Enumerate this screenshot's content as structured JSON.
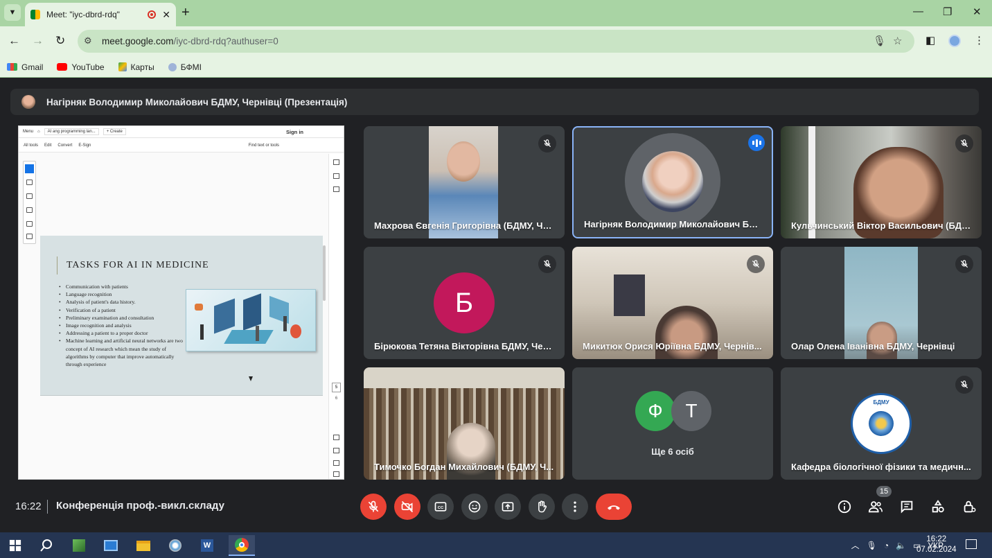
{
  "browser": {
    "tab_title": "Meet: \"iyc-dbrd-rdq\"",
    "url_host": "meet.google.com",
    "url_path": "/iyc-dbrd-rdq?authuser=0",
    "bookmarks": [
      "Gmail",
      "YouTube",
      "Карты",
      "БФМІ"
    ]
  },
  "presenter_bar": {
    "title": "Нагірняк Володимир Миколайович БДМУ, Чернівці (Презентація)"
  },
  "presentation": {
    "app_menu": "Menu",
    "doc_tab": "AI ang programming lan...",
    "create": "+ Create",
    "sign_in": "Sign in",
    "tools": [
      "All tools",
      "Edit",
      "Convert",
      "E-Sign"
    ],
    "find": "Find text or tools",
    "slide_title": "TASKS FOR AI IN MEDICINE",
    "bullets": [
      "Communication with patients",
      "Language recognition",
      "Analysis of patient's data history.",
      "Verification of a patient",
      "Preliminary examination and consultation",
      "Image recognition and analysis",
      "Addressing a patient to a proper doctor",
      "Machine learning and artificial neural networks are two concept of AI research which mean the study of algorithms by computer that improve automatically through experience"
    ],
    "page_number": "5",
    "page_total": "6"
  },
  "participants": [
    {
      "name": "Махрова Євгенія Григорівна (БДМУ, Че...",
      "muted": true
    },
    {
      "name": "Нагірняк Володимир Миколайович БД...",
      "speaking": true
    },
    {
      "name": "Кульчинський Віктор Васильович (БДМ...",
      "muted": true
    },
    {
      "name": "Бірюкова Тетяна Вікторівна БДМУ, Чер...",
      "muted": true,
      "initial": "Б",
      "color": "#c2185b"
    },
    {
      "name": "Микитюк Орися Юріївна БДМУ, Чернів...",
      "muted": true
    },
    {
      "name": "Олар Олена Іванівна БДМУ, Чернівці",
      "muted": true
    },
    {
      "name": "Тимочко Богдан Михайлович (БДМУ, Ч..."
    },
    {
      "name": "Ще 6 осіб",
      "initials": [
        "Ф",
        "Т"
      ],
      "colors": [
        "#34a853",
        "#5f6368"
      ]
    },
    {
      "name": "Кафедра біологічної фізики та медичн...",
      "muted": true,
      "logo_text": "БДМУ"
    }
  ],
  "meeting": {
    "time": "16:22",
    "title": "Конференція проф.-викл.складу",
    "participant_count": "15"
  },
  "taskbar": {
    "lang": "УКР",
    "time": "16:22",
    "date": "07.02.2024"
  },
  "colors": {
    "accent": "#1a73e8",
    "danger": "#ea4335",
    "bg": "#202124",
    "tile": "#3c4043"
  }
}
